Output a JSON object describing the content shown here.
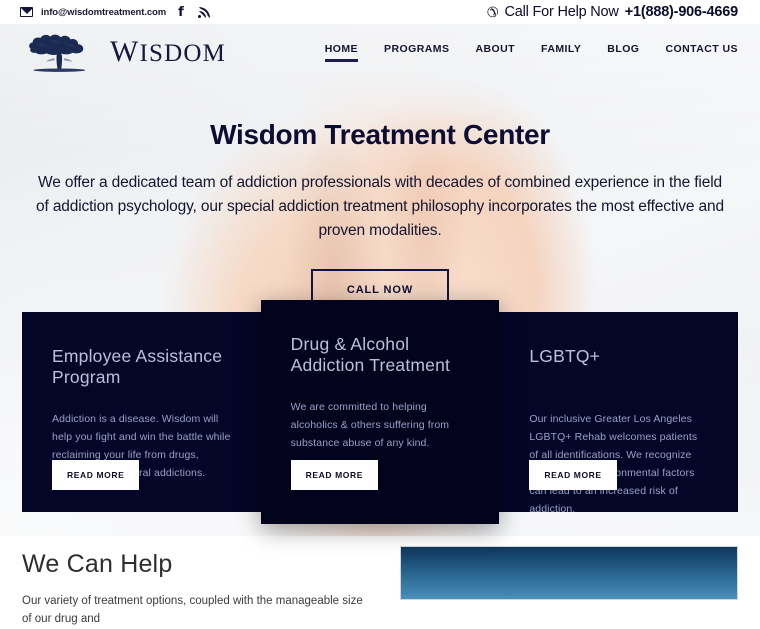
{
  "topbar": {
    "email": "info@wisdomtreatment.com",
    "mail_icon": "envelope-icon",
    "facebook_glyph": "f",
    "rss_icon": "rss-icon",
    "call_label": "Call For Help Now",
    "call_number": "+1(888)-906-4669",
    "phone_glyph": "✆"
  },
  "header": {
    "logo_word_cap": "W",
    "logo_word_rest": "ISDOM",
    "logo_icon": "tree-logo-icon",
    "nav": [
      {
        "label": "HOME",
        "active": true
      },
      {
        "label": "PROGRAMS",
        "active": false
      },
      {
        "label": "ABOUT",
        "active": false
      },
      {
        "label": "FAMILY",
        "active": false
      },
      {
        "label": "BLOG",
        "active": false
      },
      {
        "label": "CONTACT US",
        "active": false
      }
    ]
  },
  "hero": {
    "title": "Wisdom Treatment Center",
    "subtitle": "We offer a dedicated team of addiction professionals with decades of combined experience in the field of addiction psychology, our special addiction treatment philosophy incorporates the most effective and proven modalities.",
    "cta_label": "CALL NOW"
  },
  "cards": [
    {
      "title": "Employee Assistance Program",
      "text": "Addiction is a disease. Wisdom will help you fight and win the battle while reclaiming your life from drugs, alcohol or behavioral addictions.",
      "button": "READ MORE"
    },
    {
      "title": "Drug & Alcohol Addiction Treatment",
      "text": "We are committed to helping alcoholics & others suffering from substance abuse of any kind.",
      "button": "READ MORE"
    },
    {
      "title": "LGBTQ+",
      "text": "Our inclusive Greater Los Angeles LGBTQ+ Rehab welcomes patients of all identifications.  We recognize that different environmental factors can lead to an increased risk of addiction.",
      "button": "READ MORE"
    }
  ],
  "help_section": {
    "title": "We Can Help",
    "text": "Our variety of treatment options, coupled with the manageable size of our drug and",
    "image_alt": "ocean-horizon-image"
  },
  "colors": {
    "navy": "#050528",
    "navy_dark": "#03031d",
    "text_dark": "#0d0d33",
    "card_title": "#b9c0da",
    "card_text": "#98a2c4",
    "image_blue": "#2d6c96"
  }
}
